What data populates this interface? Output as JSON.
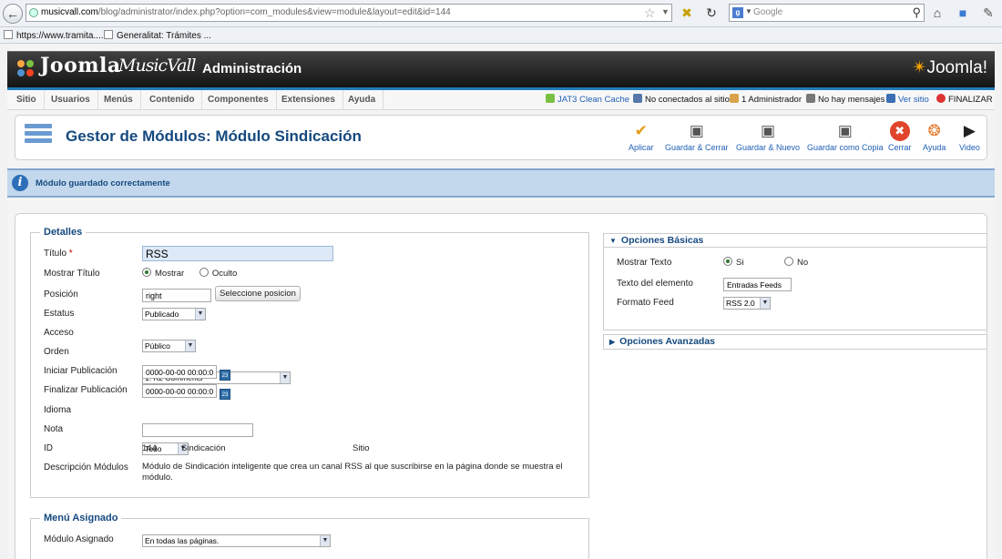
{
  "browser": {
    "url_host": "musicvall.com",
    "url_path": "/blog/administrator/index.php?option=com_modules&view=module&layout=edit&id=144",
    "search_placeholder": "Google",
    "bookmarks": [
      "https://www.tramita....",
      "Generalitat: Trámites ..."
    ]
  },
  "header": {
    "logo_text": "Joomla",
    "site_logo": "MusicVall",
    "title": "Administración",
    "brand_right": "Joomla!"
  },
  "menu": {
    "items": [
      "Sitio",
      "Usuarios",
      "Menús",
      "Contenido",
      "Componentes",
      "Extensiones",
      "Ayuda"
    ],
    "status": {
      "cache": "JAT3 Clean Cache",
      "connected": "No conectados al sitio",
      "admins": "1 Administrador",
      "messages": "No hay mensajes",
      "view_site": "Ver sitio",
      "logout": "FINALIZAR"
    }
  },
  "toolbar": {
    "page_title": "Gestor de Módulos: Módulo Sindicación",
    "buttons": [
      "Aplicar",
      "Guardar & Cerrar",
      "Guardar & Nuevo",
      "Guardar como Copia",
      "Cerrar",
      "Ayuda",
      "Video"
    ]
  },
  "message": {
    "text": "Módulo guardado correctamente"
  },
  "details": {
    "legend": "Detalles",
    "title_label": "Título",
    "title_required": "*",
    "title_value": "RSS",
    "show_title_label": "Mostrar Título",
    "show_option": "Mostrar",
    "hide_option": "Oculto",
    "position_label": "Posición",
    "position_value": "right",
    "position_button": "Seleccione posicion",
    "status_label": "Estatus",
    "status_value": "Publicado",
    "access_label": "Acceso",
    "access_value": "Público",
    "order_label": "Orden",
    "order_value": "1. K2 Comments",
    "start_label": "Iniciar Publicación",
    "start_value": "0000-00-00 00:00:00",
    "end_label": "Finalizar Publicación",
    "end_value": "0000-00-00 00:00:00",
    "calendar_text": "23",
    "language_label": "Idioma",
    "language_value": "Todo",
    "note_label": "Nota",
    "note_value": "",
    "id_label": "ID",
    "id_value": "144",
    "module_type": "Sindicación",
    "client": "Sitio",
    "desc_label": "Descripción Módulos",
    "desc_text": "Módulo de Sindicación inteligente que crea un canal RSS al que suscribirse en la página donde se muestra el módulo."
  },
  "menu_assignment": {
    "legend": "Menú Asignado",
    "label": "Módulo Asignado",
    "value": "En todas las páginas."
  },
  "basic_options": {
    "legend": "Opciones Básicas",
    "show_text_label": "Mostrar Texto",
    "yes": "Si",
    "no": "No",
    "element_text_label": "Texto del elemento",
    "element_text_value": "Entradas Feeds",
    "format_label": "Formato Feed",
    "format_value": "RSS 2.0"
  },
  "advanced_options": {
    "legend": "Opciones Avanzadas"
  }
}
